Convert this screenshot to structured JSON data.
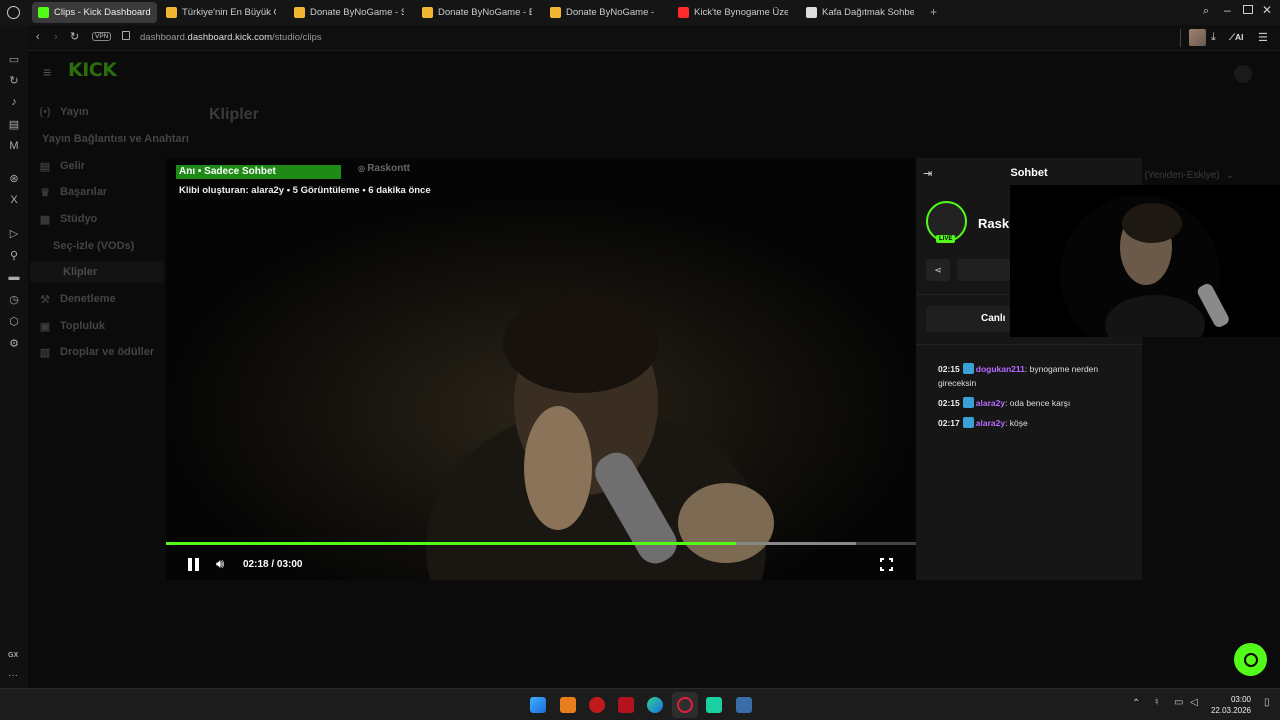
{
  "browser": {
    "tabs": [
      {
        "label": "Clips - Kick Dashboard",
        "active": true,
        "favicon_color": "#53fc18"
      },
      {
        "label": "Türkiye'nin En Büyük Oyu",
        "favicon_color": "#f2b633"
      },
      {
        "label": "Donate ByNoGame - Strea",
        "favicon_color": "#f2b633"
      },
      {
        "label": "Donate ByNoGame - BNG",
        "favicon_color": "#f2b633"
      },
      {
        "label": "Donate ByNoGame - BNG",
        "favicon_color": "#f2b633"
      },
      {
        "label": "Kick'te Bynogame Üzerin",
        "favicon_color": "#ff2a2a"
      },
      {
        "label": "Kafa Dağıtmak Sohbeti",
        "favicon_color": "#dddddd"
      }
    ],
    "vpn_label": "VPN",
    "url_host": "dashboard.kick.com",
    "url_path": "/studio/clips",
    "ai_label": "AI"
  },
  "app": {
    "logo": "KICK",
    "logo_color": "#53fc18",
    "page_title": "Klipler",
    "sort_label": "arih (Yeniden-Eskiye)"
  },
  "nav": {
    "items": [
      {
        "label": "Yayın",
        "icon": "broadcast-icon",
        "glyph": "(•)"
      },
      {
        "label": "Yayın Bağlantısı ve Anahtarı",
        "sub": true
      },
      {
        "label": "Gelir",
        "icon": "revenue-icon",
        "glyph": "▤"
      },
      {
        "label": "Başarılar",
        "icon": "trophy-icon",
        "glyph": "♛"
      },
      {
        "label": "Stüdyo",
        "icon": "studio-icon",
        "glyph": "▦"
      },
      {
        "label": "Seç-izle (VODs)",
        "sub": true
      },
      {
        "label": "Klipler",
        "sub": true,
        "active": true
      },
      {
        "label": "Denetleme",
        "icon": "moderation-icon",
        "glyph": "⚒"
      },
      {
        "label": "Topluluk",
        "icon": "community-icon",
        "glyph": "▣"
      },
      {
        "label": "Droplar ve ödüller",
        "icon": "drops-icon",
        "glyph": "▥"
      }
    ]
  },
  "video": {
    "banner": "Anı • Sadece Sohbet",
    "watermark": "Raskontt",
    "clip_info": "Klibi oluşturan: alara2y • 5 Görüntüleme • 6 dakika önce",
    "time": "02:18 / 03:00",
    "progress": 0.76,
    "buffered": 0.92,
    "accent": "#53fc18"
  },
  "chat": {
    "header": "Sohbet",
    "channel_name": "Rask",
    "live_badge": "LIVE",
    "canli_label": "Canlı",
    "messages": [
      {
        "time": "02:15",
        "user": "dogukan211",
        "text": ": bynogame nerden gireceksin"
      },
      {
        "time": "02:15",
        "user": "alara2y",
        "text": ": oda bence karşı"
      },
      {
        "time": "02:17",
        "user": "alara2y",
        "text": ": köşe"
      }
    ]
  },
  "browser_sidebar": {
    "gx_label": "GX",
    "more_label": "···"
  },
  "taskbar": {
    "clock_time": "03:00",
    "clock_date": "22.03.2026"
  }
}
